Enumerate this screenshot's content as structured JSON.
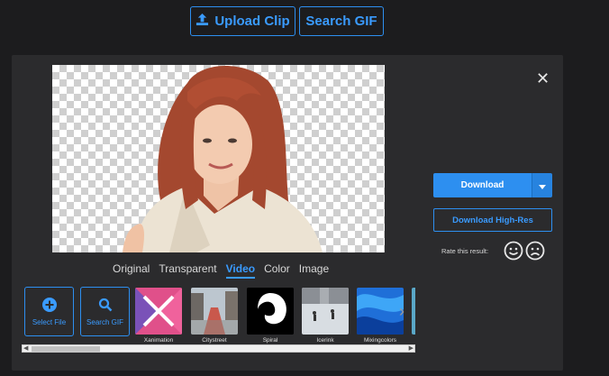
{
  "header": {
    "upload_label": "Upload Clip",
    "search_label": "Search GIF"
  },
  "modal": {
    "close_glyph": "✕",
    "tabs": [
      {
        "label": "Original",
        "active": false
      },
      {
        "label": "Transparent",
        "active": false
      },
      {
        "label": "Video",
        "active": true
      },
      {
        "label": "Color",
        "active": false
      },
      {
        "label": "Image",
        "active": false
      }
    ],
    "tools": {
      "select_file_label": "Select File",
      "search_gif_label": "Search GIF"
    },
    "backgrounds": [
      {
        "label": "Xanimation"
      },
      {
        "label": "Citystreet"
      },
      {
        "label": "Spiral"
      },
      {
        "label": "Icerink"
      },
      {
        "label": "Mixingcolors"
      }
    ],
    "download_label": "Download",
    "download_hires_label": "Download High-Res",
    "rate_label": "Rate this result:"
  },
  "colors": {
    "accent": "#2d8ff0",
    "background": "#1c1c1e",
    "panel": "#2b2b2d"
  }
}
